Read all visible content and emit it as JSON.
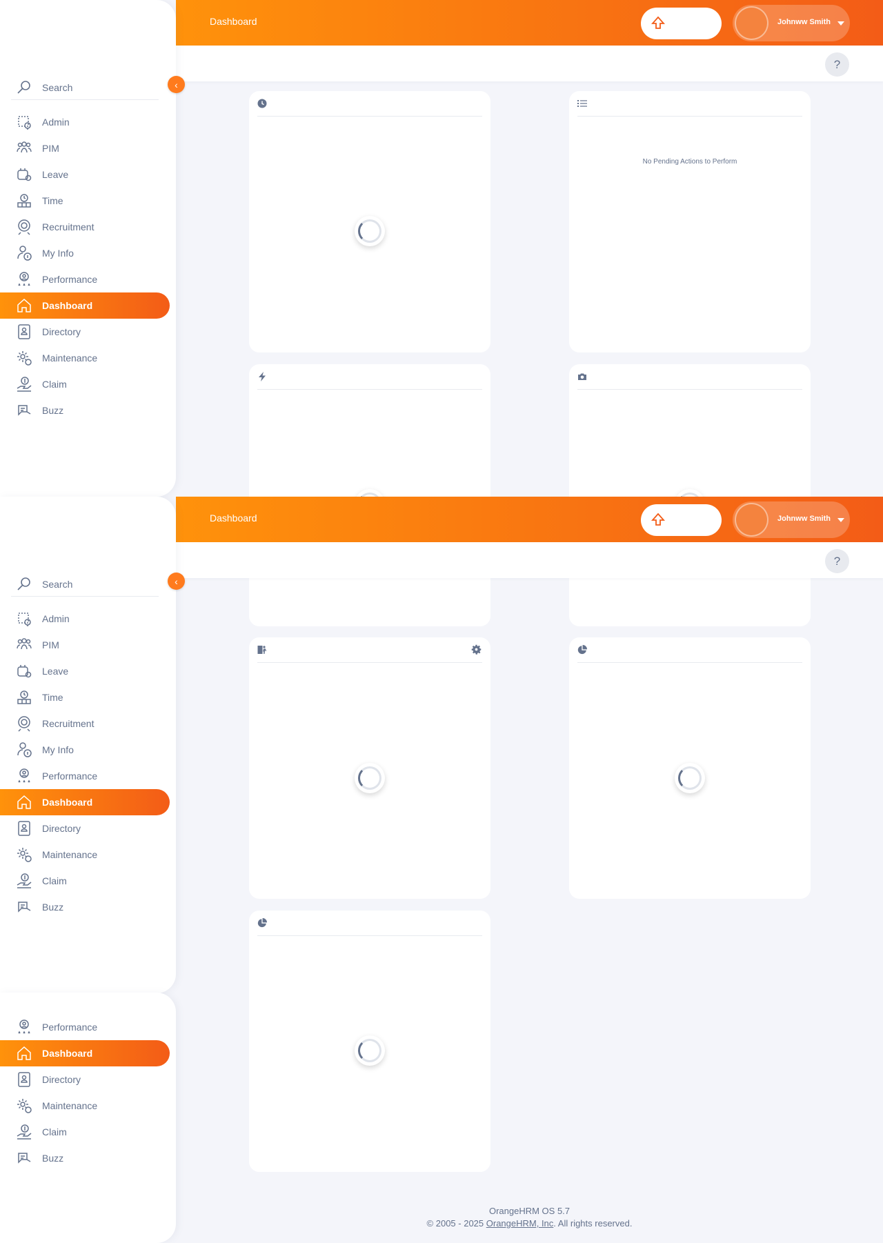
{
  "header": {
    "title": "Dashboard",
    "user_name": "Johnww Smith"
  },
  "sidebar": {
    "search_label": "Search",
    "items": [
      {
        "label": "Admin",
        "icon": "admin-icon"
      },
      {
        "label": "PIM",
        "icon": "pim-icon"
      },
      {
        "label": "Leave",
        "icon": "leave-icon"
      },
      {
        "label": "Time",
        "icon": "time-icon"
      },
      {
        "label": "Recruitment",
        "icon": "recruitment-icon"
      },
      {
        "label": "My Info",
        "icon": "my-info-icon"
      },
      {
        "label": "Performance",
        "icon": "performance-icon"
      },
      {
        "label": "Dashboard",
        "icon": "dashboard-icon",
        "active": true
      },
      {
        "label": "Directory",
        "icon": "directory-icon"
      },
      {
        "label": "Maintenance",
        "icon": "maintenance-icon"
      },
      {
        "label": "Claim",
        "icon": "claim-icon"
      },
      {
        "label": "Buzz",
        "icon": "buzz-icon"
      }
    ]
  },
  "widgets": {
    "pending_actions_empty": "No Pending Actions to Perform",
    "icons": [
      "clock-icon",
      "list-icon",
      "bolt-icon",
      "camera-icon",
      "person-exit-icon",
      "gear-icon",
      "pie-chart-icon"
    ]
  },
  "footer": {
    "version": "OrangeHRM OS 5.7",
    "copyright_prefix": "© 2005 - 2025 ",
    "company_link": "OrangeHRM, Inc",
    "rights": ". All rights reserved."
  },
  "colors": {
    "accent": "#ff7b1d",
    "gradient_start": "#ff920b",
    "gradient_end": "#f35c17",
    "text": "#64728c",
    "background": "#f4f5fa"
  }
}
